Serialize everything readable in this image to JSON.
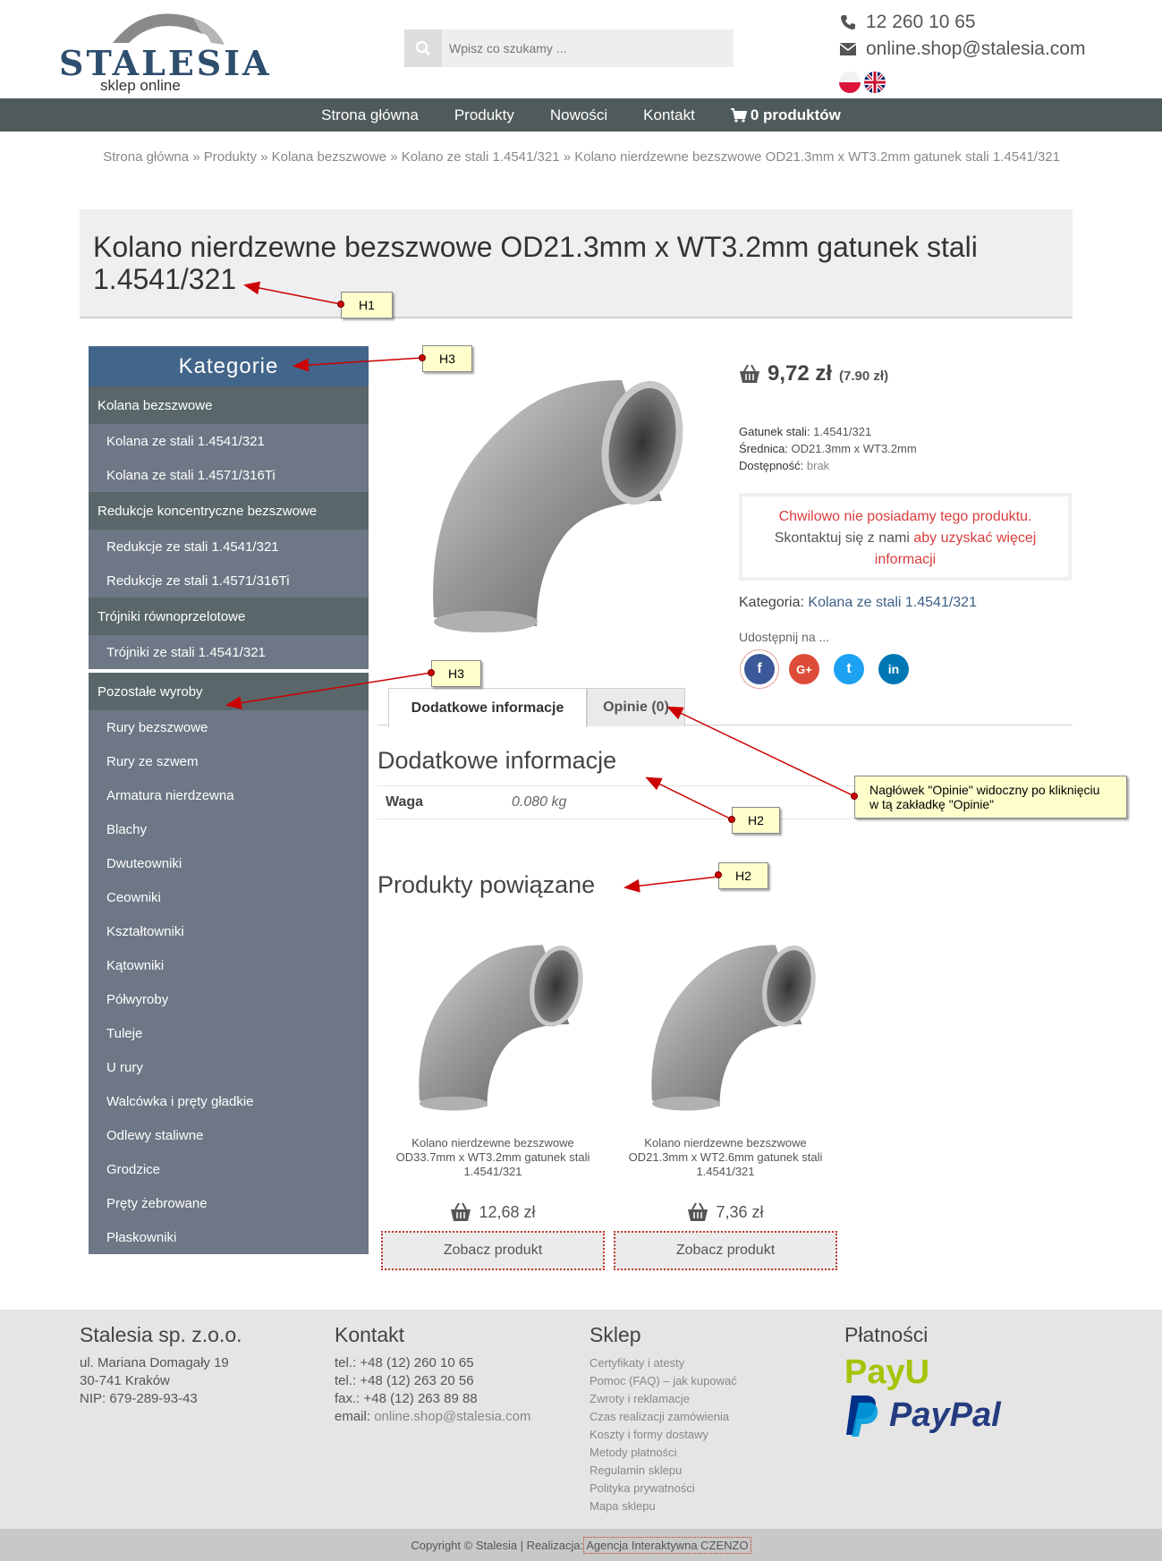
{
  "header": {
    "logo_text": "STALESIA",
    "logo_sub": "sklep online",
    "search_placeholder": "Wpisz co szukamy ...",
    "phone": "12 260 10 65",
    "email": "online.shop@stalesia.com",
    "languages": [
      "pl",
      "en"
    ]
  },
  "nav": {
    "items": [
      "Strona główna",
      "Produkty",
      "Nowości",
      "Kontakt"
    ],
    "cart": "0 produktów"
  },
  "breadcrumb": "Strona główna » Produkty » Kolana bezszwowe » Kolano ze stali 1.4541/321 » Kolano nierdzewne bezszwowe OD21.3mm x WT3.2mm gatunek stali 1.4541/321",
  "product": {
    "title": "Kolano nierdzewne bezszwowe OD21.3mm x WT3.2mm gatunek stali 1.4541/321",
    "price": "9,72 zł",
    "price_net": "(7.90 zł)",
    "specs": [
      {
        "label": "Gatunek stali:",
        "value": "1.4541/321"
      },
      {
        "label": "Średnica:",
        "value": "OD21.3mm x WT3.2mm"
      },
      {
        "label": "Dostępność:",
        "value": "brak"
      }
    ],
    "notice_line1": "Chwilowo nie posiadamy tego produktu.",
    "notice_line2_a": "Skontaktuj się z nami",
    "notice_line2_b": "aby uzyskać więcej",
    "notice_line3": "informacji",
    "category_label": "Kategoria:",
    "category_value": "Kolana ze stali 1.4541/321",
    "share_label": "Udostępnij na ...",
    "social": [
      {
        "name": "facebook",
        "color": "#3b5998",
        "glyph": "f"
      },
      {
        "name": "google-plus",
        "color": "#dd4b39",
        "glyph": "G+"
      },
      {
        "name": "twitter",
        "color": "#1da1f2",
        "glyph": "t"
      },
      {
        "name": "linkedin",
        "color": "#0077b5",
        "glyph": "in"
      }
    ]
  },
  "sidebar": {
    "title": "Kategorie",
    "groups": [
      {
        "name": "Kolana bezszwowe",
        "items": [
          "Kolana ze stali 1.4541/321",
          "Kolana ze stali 1.4571/316Ti"
        ]
      },
      {
        "name": "Redukcje koncentryczne bezszwowe",
        "items": [
          "Redukcje ze stali 1.4541/321",
          "Redukcje ze stali 1.4571/316Ti"
        ]
      },
      {
        "name": "Trójniki równoprzelotowe",
        "items": [
          "Trójniki ze stali 1.4541/321"
        ]
      },
      {
        "name": "Pozostałe wyroby",
        "items": [
          "Rury bezszwowe",
          "Rury ze szwem",
          "Armatura nierdzewna",
          "Blachy",
          "Dwuteowniki",
          "Ceowniki",
          "Kształtowniki",
          "Kątowniki",
          "Półwyroby",
          "Tuleje",
          "U rury",
          "Walcówka i pręty gładkie",
          "Odlewy staliwne",
          "Grodzice",
          "Pręty żebrowane",
          "Płaskowniki"
        ]
      }
    ]
  },
  "tabs": [
    "Dodatkowe informacje",
    "Opinie (0)"
  ],
  "info": {
    "heading": "Dodatkowe informacje",
    "weight_label": "Waga",
    "weight_value": "0.080 kg"
  },
  "related": {
    "heading": "Produkty powiązane",
    "items": [
      {
        "name": "Kolano nierdzewne bezszwowe OD33.7mm x WT3.2mm gatunek stali 1.4541/321",
        "price": "12,68 zł",
        "button": "Zobacz produkt"
      },
      {
        "name": "Kolano nierdzewne bezszwowe OD21.3mm x WT2.6mm gatunek stali 1.4541/321",
        "price": "7,36 zł",
        "button": "Zobacz produkt"
      }
    ]
  },
  "footer": {
    "company": {
      "title": "Stalesia sp. z.o.o.",
      "lines": [
        "ul. Mariana Domagały 19",
        "30-741 Kraków",
        "NIP: 679-289-93-43"
      ]
    },
    "contact": {
      "title": "Kontakt",
      "lines": [
        "tel.: +48 (12) 260 10 65",
        "tel.: +48 (12) 263 20 56",
        "fax.: +48 (12) 263 89 88"
      ],
      "email_label": "email:",
      "email": "online.shop@stalesia.com"
    },
    "shop": {
      "title": "Sklep",
      "links": [
        "Certyfikaty i atesty",
        "Pomoc (FAQ) – jak kupować",
        "Zwroty i reklamacje",
        "Czas realizacji zamówienia",
        "Koszty i formy dostawy",
        "Metody płatności",
        "Regulamin sklepu",
        "Polityka prywatności",
        "Mapa sklepu"
      ]
    },
    "payments": {
      "title": "Płatności",
      "logos": [
        "PayU",
        "PayPal"
      ]
    },
    "copyright": "Copyright © Stalesia | Realizacja:",
    "agency": "Agencja Interaktywna CZENZO"
  },
  "annotations": {
    "h1": "H1",
    "h3a": "H3",
    "h3b": "H3",
    "h2a": "H2",
    "h2b": "H2",
    "opinie_note_1": "Nagłówek \"Opinie\" widoczny po kliknięciu",
    "opinie_note_2": "w tą zakładkę \"Opinie\""
  }
}
